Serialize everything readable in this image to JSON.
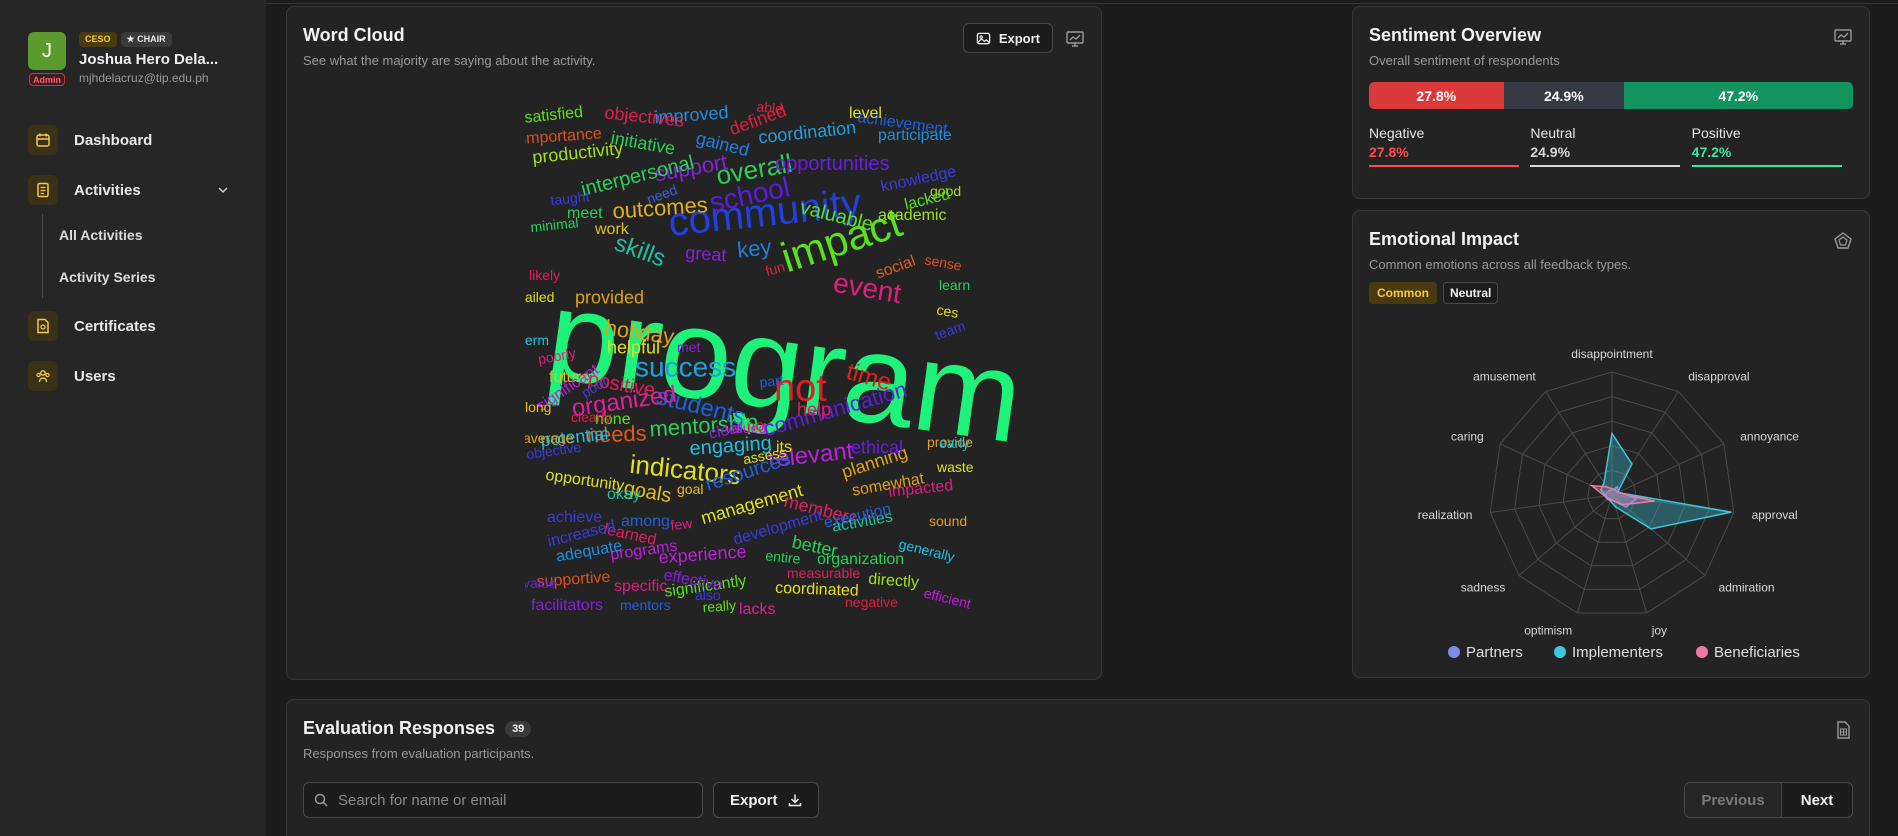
{
  "profile": {
    "initial": "J",
    "admin_badge": "Admin",
    "badges": [
      "CESO",
      "★ CHAIR"
    ],
    "name": "Joshua Hero Dela...",
    "email": "mjhdelacruz@tip.edu.ph"
  },
  "nav": {
    "dashboard": "Dashboard",
    "activities": "Activities",
    "all_activities": "All Activities",
    "activity_series": "Activity Series",
    "certificates": "Certificates",
    "users": "Users"
  },
  "wordcloud": {
    "title": "Word Cloud",
    "subtitle": "See what the majority are saying about the activity.",
    "export_label": "Export",
    "words": [
      {
        "t": "program",
        "c": "#1ef27a"
      },
      {
        "t": "community",
        "c": "#2040e0"
      },
      {
        "t": "impact",
        "c": "#5ae01e"
      },
      {
        "t": "not",
        "c": "#e01e28"
      },
      {
        "t": "success",
        "c": "#1ea0e0"
      },
      {
        "t": "school",
        "c": "#5a1ee0"
      },
      {
        "t": "overall",
        "c": "#2ad05a"
      },
      {
        "t": "outcomes",
        "c": "#e0b01e"
      },
      {
        "t": "skills",
        "c": "#1ec0a0"
      },
      {
        "t": "holiday",
        "c": "#e0a01e"
      },
      {
        "t": "students",
        "c": "#1e60e0"
      },
      {
        "t": "organized",
        "c": "#e01ea0"
      },
      {
        "t": "mentorship",
        "c": "#2ad05a"
      },
      {
        "t": "relevant",
        "c": "#c01ee0"
      },
      {
        "t": "indicators",
        "c": "#e0e01e"
      },
      {
        "t": "event",
        "c": "#e01e80"
      },
      {
        "t": "communication",
        "c": "#5a1ee0"
      },
      {
        "t": "support",
        "c": "#8a1ee0"
      },
      {
        "t": "interpersonal",
        "c": "#2ad05a"
      },
      {
        "t": "opportunities",
        "c": "#6a1ee0"
      },
      {
        "t": "valuable",
        "c": "#5ae01e"
      },
      {
        "t": "coordination",
        "c": "#1ea0e0"
      },
      {
        "t": "needs",
        "c": "#e05a1e"
      },
      {
        "t": "engaging",
        "c": "#1ec0e0"
      },
      {
        "t": "management",
        "c": "#e0e01e"
      },
      {
        "t": "resources",
        "c": "#2060e0"
      },
      {
        "t": "positive",
        "c": "#e01e60"
      },
      {
        "t": "time",
        "c": "#e0201e"
      },
      {
        "t": "key",
        "c": "#1e80e0"
      },
      {
        "t": "great",
        "c": "#8a1ee0"
      },
      {
        "t": "goals",
        "c": "#e0c01e"
      },
      {
        "t": "productivity",
        "c": "#a0e01e"
      },
      {
        "t": "improved",
        "c": "#1e90e0"
      },
      {
        "t": "objectives",
        "c": "#e01e50"
      },
      {
        "t": "satisfied",
        "c": "#5ae01e"
      },
      {
        "t": "importance",
        "c": "#e0501e"
      },
      {
        "t": "initiative",
        "c": "#2ad05a"
      },
      {
        "t": "gained",
        "c": "#1e80e0"
      },
      {
        "t": "defined",
        "c": "#e01e40"
      },
      {
        "t": "achievement",
        "c": "#1e60e0"
      },
      {
        "t": "participate",
        "c": "#1e90e0"
      },
      {
        "t": "knowledge",
        "c": "#3a3ae0"
      },
      {
        "t": "academic",
        "c": "#a0e01e"
      },
      {
        "t": "social",
        "c": "#e0601e"
      },
      {
        "t": "members",
        "c": "#e01e60"
      },
      {
        "t": "planning",
        "c": "#e0a01e"
      },
      {
        "t": "experience",
        "c": "#c01ee0"
      },
      {
        "t": "better",
        "c": "#2ad05a"
      },
      {
        "t": "organization",
        "c": "#2ad05a"
      },
      {
        "t": "coordinated",
        "c": "#e0e01e"
      },
      {
        "t": "significantly",
        "c": "#5ae01e"
      },
      {
        "t": "activities",
        "c": "#1ec0a0"
      },
      {
        "t": "impacted",
        "c": "#e01e80"
      },
      {
        "t": "somewhat",
        "c": "#e0a01e"
      },
      {
        "t": "helpful",
        "c": "#e0e01e"
      },
      {
        "t": "provided",
        "c": "#e0a01e"
      },
      {
        "t": "future",
        "c": "#e0c01e"
      },
      {
        "t": "potential",
        "c": "#1ec0e0"
      },
      {
        "t": "opportunity",
        "c": "#e0e01e"
      },
      {
        "t": "learned",
        "c": "#e01e60"
      },
      {
        "t": "programs",
        "c": "#c01ee0"
      },
      {
        "t": "adequate",
        "c": "#1e90e0"
      },
      {
        "t": "supportive",
        "c": "#e0501e"
      },
      {
        "t": "facilitators",
        "c": "#8a1ee0"
      },
      {
        "t": "mentors",
        "c": "#2060e0"
      },
      {
        "t": "lacks",
        "c": "#e01ea0"
      },
      {
        "t": "negative",
        "c": "#e01e40"
      },
      {
        "t": "efficient",
        "c": "#c01ee0"
      },
      {
        "t": "directly",
        "c": "#a0e01e"
      },
      {
        "t": "measurable",
        "c": "#e01e60"
      },
      {
        "t": "specific",
        "c": "#e01e80"
      },
      {
        "t": "effective",
        "c": "#8a1ee0"
      },
      {
        "t": "really",
        "c": "#5ae01e"
      },
      {
        "t": "entire",
        "c": "#2ad05a"
      },
      {
        "t": "generally",
        "c": "#1ec0e0"
      },
      {
        "t": "sound",
        "c": "#e0a01e"
      },
      {
        "t": "waste",
        "c": "#e0e01e"
      },
      {
        "t": "provide",
        "c": "#e0a01e"
      },
      {
        "t": "ethical",
        "c": "#6a1ee0"
      },
      {
        "t": "help",
        "c": "#e01e60"
      },
      {
        "t": "clear",
        "c": "#8a1ee0"
      },
      {
        "t": "none",
        "c": "#5ae01e"
      },
      {
        "t": "okay",
        "c": "#1ec0a0"
      },
      {
        "t": "among",
        "c": "#1e60e0"
      },
      {
        "t": "increased",
        "c": "#3a3ae0"
      },
      {
        "t": "achieve",
        "c": "#3a3ae0"
      },
      {
        "t": "minimal",
        "c": "#2ad05a"
      },
      {
        "t": "work",
        "c": "#e0c01e"
      },
      {
        "t": "meet",
        "c": "#2ad05a"
      },
      {
        "t": "need",
        "c": "#3a60e0"
      },
      {
        "t": "taught",
        "c": "#3a3ae0"
      },
      {
        "t": "likely",
        "c": "#e01e60"
      },
      {
        "t": "failed",
        "c": "#e0e01e"
      },
      {
        "t": "term",
        "c": "#1ec0e0"
      },
      {
        "t": "poorly",
        "c": "#e01e80"
      },
      {
        "t": "significant",
        "c": "#c01ee0"
      },
      {
        "t": "poor",
        "c": "#3a3ae0"
      },
      {
        "t": "long",
        "c": "#e0c01e"
      },
      {
        "t": "average",
        "c": "#e0a01e"
      },
      {
        "t": "clearly",
        "c": "#e01e40"
      },
      {
        "t": "objective",
        "c": "#3a3ae0"
      },
      {
        "t": "valued",
        "c": "#c01ee0"
      },
      {
        "t": "no",
        "c": "#e01e40"
      },
      {
        "t": "its",
        "c": "#e0e01e"
      },
      {
        "t": "assess",
        "c": "#e0e01e"
      },
      {
        "t": "goal",
        "c": "#e0c01e"
      },
      {
        "t": "few",
        "c": "#e01e80"
      },
      {
        "t": "execution",
        "c": "#2060e0"
      },
      {
        "t": "development",
        "c": "#3a3ae0"
      },
      {
        "t": "value",
        "c": "#6a1ee0"
      },
      {
        "t": "fun",
        "c": "#e01e40"
      },
      {
        "t": "sense",
        "c": "#e0501e"
      },
      {
        "t": "learn",
        "c": "#2ad05a"
      },
      {
        "t": "team",
        "c": "#3a3ae0"
      },
      {
        "t": "ces",
        "c": "#e0e01e"
      },
      {
        "t": "early",
        "c": "#1ec0e0"
      },
      {
        "t": "good",
        "c": "#a0e01e"
      },
      {
        "t": "lacked",
        "c": "#5ae01e"
      },
      {
        "t": "level",
        "c": "#e0e01e"
      },
      {
        "t": "able",
        "c": "#e01e40"
      },
      {
        "t": "met",
        "c": "#8a1ee0"
      },
      {
        "t": "part",
        "c": "#1e60e0"
      },
      {
        "t": "also",
        "c": "#3a3ae0"
      }
    ]
  },
  "sentiment": {
    "title": "Sentiment Overview",
    "subtitle": "Overall sentiment of respondents",
    "segments": [
      {
        "label": "Negative",
        "value": "27.8%",
        "pct": 27.8,
        "color": "#dc3a3a",
        "text_color": "#ff4d4d"
      },
      {
        "label": "Neutral",
        "value": "24.9%",
        "pct": 24.9,
        "color": "#353a44",
        "text_color": "#d8d8d8"
      },
      {
        "label": "Positive",
        "value": "47.2%",
        "pct": 47.2,
        "color": "#13935f",
        "text_color": "#3ee6a4"
      }
    ]
  },
  "emotional": {
    "title": "Emotional Impact",
    "subtitle": "Common emotions across all feedback types.",
    "tags": [
      "Common",
      "Neutral"
    ],
    "axes": [
      "disappointment",
      "disapproval",
      "annoyance",
      "approval",
      "admiration",
      "joy",
      "optimism",
      "sadness",
      "realization",
      "caring",
      "amusement"
    ],
    "series": [
      {
        "name": "Partners",
        "color": "#7b8cf0",
        "values": [
          0.04,
          0.08,
          0.06,
          0.2,
          0.15,
          0.05,
          0.03,
          0.04,
          0.05,
          0.05,
          0.04
        ]
      },
      {
        "name": "Implementers",
        "color": "#3cc7dc",
        "values": [
          0.5,
          0.3,
          0.05,
          0.98,
          0.42,
          0.1,
          0.05,
          0.05,
          0.05,
          0.1,
          0.12
        ]
      },
      {
        "name": "Beneficiaries",
        "color": "#ef7aa6",
        "values": [
          0.05,
          0.05,
          0.05,
          0.35,
          0.12,
          0.05,
          0.04,
          0.05,
          0.06,
          0.18,
          0.08
        ]
      }
    ]
  },
  "evaluation": {
    "title": "Evaluation Responses",
    "count": "39",
    "subtitle": "Responses from evaluation participants.",
    "search_placeholder": "Search for name or email",
    "export_label": "Export",
    "previous_label": "Previous",
    "next_label": "Next"
  },
  "colors": {
    "accent_gold": "#f6c945",
    "icon_bg": "#3a3218"
  }
}
